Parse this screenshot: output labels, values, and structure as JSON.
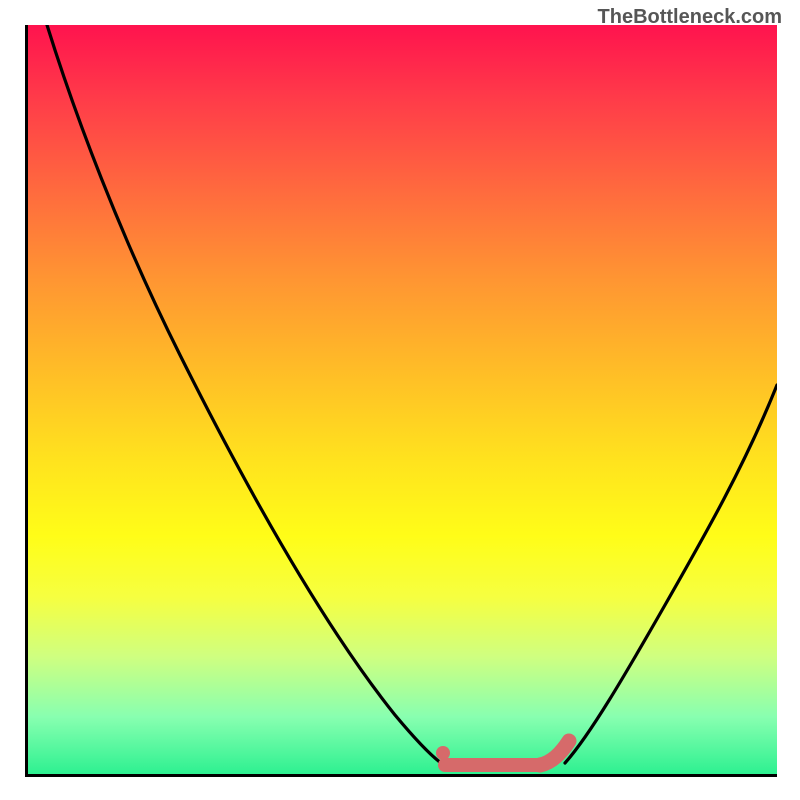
{
  "watermark": "TheBottleneck.com",
  "chart_data": {
    "type": "line",
    "title": "",
    "xlabel": "",
    "ylabel": "",
    "xlim": [
      0,
      100
    ],
    "ylim": [
      0,
      100
    ],
    "grid": false,
    "background_gradient": {
      "top": "#ff134e",
      "bottom": "#29f08f",
      "description": "red-to-green vertical gradient (bottleneck severity)"
    },
    "series": [
      {
        "name": "bottleneck-curve-left",
        "color": "#000000",
        "x": [
          3,
          10,
          20,
          30,
          40,
          50,
          55
        ],
        "y": [
          100,
          82,
          62,
          42,
          24,
          8,
          3
        ]
      },
      {
        "name": "bottleneck-curve-right",
        "color": "#000000",
        "x": [
          72,
          78,
          85,
          92,
          100
        ],
        "y": [
          3,
          10,
          22,
          36,
          52
        ]
      },
      {
        "name": "optimal-range-marker",
        "color": "#d66a6a",
        "type": "marker-segment",
        "x": [
          55,
          58,
          62,
          66,
          70,
          72
        ],
        "y": [
          3,
          1.5,
          1.5,
          1.5,
          2,
          4
        ]
      }
    ],
    "annotations": []
  }
}
